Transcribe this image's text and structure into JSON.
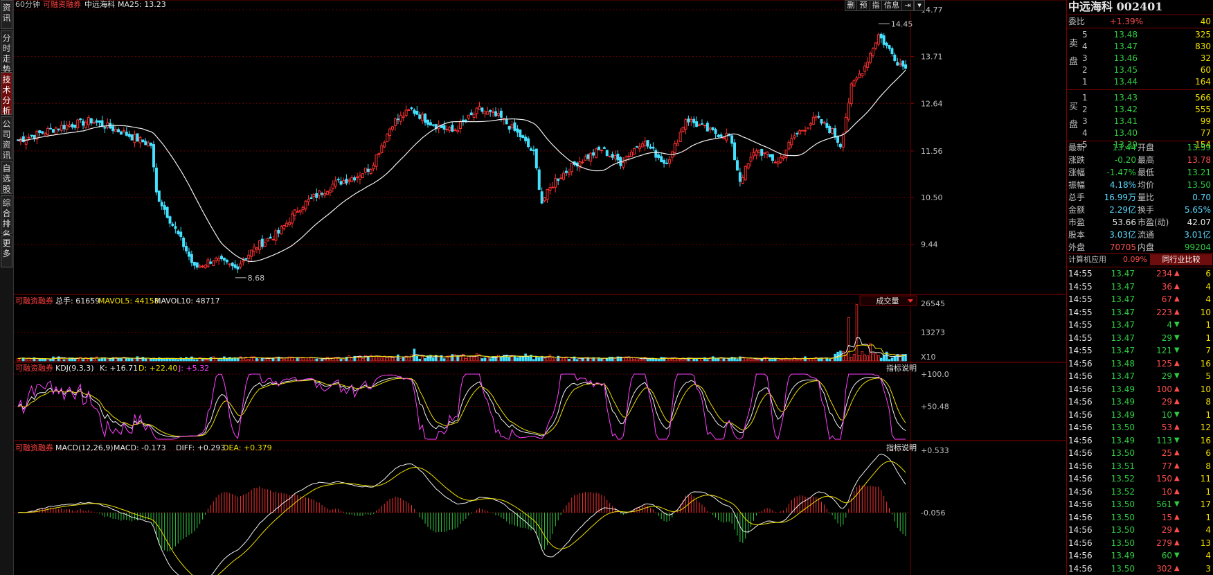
{
  "sidebar": {
    "tabs": [
      {
        "label": "资讯",
        "active": false
      },
      {
        "label": "分时走势",
        "active": false
      },
      {
        "label": "技术分析",
        "active": true
      },
      {
        "label": "公司资讯",
        "active": false
      },
      {
        "label": "自选股",
        "active": false
      },
      {
        "label": "综合排名",
        "active": false
      },
      {
        "label": "更多",
        "active": false
      }
    ]
  },
  "main_chart": {
    "period": "60分钟",
    "margin_tag": "可融资融券",
    "name": "中远海科",
    "ma_text": "MA25: 13.23",
    "price_axis": [
      "14.77",
      "13.71",
      "12.64",
      "11.56",
      "10.50",
      "9.44"
    ],
    "high_label": "14.45",
    "low_label": "8.68",
    "toolbar": [
      "删",
      "预",
      "指",
      "信息",
      "⇥",
      "▾"
    ]
  },
  "volume_panel": {
    "margin_tag": "可融资融券",
    "total": "总手: 61659",
    "mavol5": "MAVOL5: 44158",
    "mavol10": "MAVOL10: 48717",
    "dropdown": "成交量",
    "axis": [
      "26545",
      "13273",
      "X10"
    ]
  },
  "kdj_panel": {
    "margin_tag": "可融资融券",
    "title": "KDJ(9,3,3)",
    "k": "K: +16.71",
    "d": "D: +22.40",
    "j": "J: +5.32",
    "explain": "指标说明",
    "axis": [
      "+100.0",
      "+50.48"
    ]
  },
  "macd_panel": {
    "margin_tag": "可融资融券",
    "title": "MACD(12,26,9)",
    "macd": "MACD: -0.173",
    "diff": "DIFF: +0.293",
    "dea": "DEA: +0.379",
    "explain": "指标说明",
    "axis": [
      "+0.533",
      "-0.056"
    ]
  },
  "quote": {
    "title": "中远海科 002401",
    "weibi_label": "委比",
    "weibi": "+1.39%",
    "weibi_val": "40",
    "sell_label": [
      "卖",
      "盘"
    ],
    "buy_label": [
      "买",
      "盘"
    ],
    "asks": [
      {
        "lvl": "5",
        "price": "13.48",
        "vol": "325"
      },
      {
        "lvl": "4",
        "price": "13.47",
        "vol": "830"
      },
      {
        "lvl": "3",
        "price": "13.46",
        "vol": "32"
      },
      {
        "lvl": "2",
        "price": "13.45",
        "vol": "60"
      },
      {
        "lvl": "1",
        "price": "13.44",
        "vol": "164"
      }
    ],
    "bids": [
      {
        "lvl": "1",
        "price": "13.43",
        "vol": "566"
      },
      {
        "lvl": "2",
        "price": "13.42",
        "vol": "555"
      },
      {
        "lvl": "3",
        "price": "13.41",
        "vol": "99"
      },
      {
        "lvl": "4",
        "price": "13.40",
        "vol": "77"
      },
      {
        "lvl": "5",
        "price": "13.39",
        "vol": "154"
      }
    ],
    "stats": [
      {
        "l1": "最新",
        "v1": "13.44",
        "c1": "green",
        "l2": "开盘",
        "v2": "13.59",
        "c2": "green"
      },
      {
        "l1": "涨跌",
        "v1": "-0.20",
        "c1": "green",
        "l2": "最高",
        "v2": "13.78",
        "c2": "red"
      },
      {
        "l1": "涨幅",
        "v1": "-1.47%",
        "c1": "green",
        "l2": "最低",
        "v2": "13.21",
        "c2": "green"
      },
      {
        "l1": "振幅",
        "v1": "4.18%",
        "c1": "cyan",
        "l2": "均价",
        "v2": "13.50",
        "c2": "green"
      },
      {
        "l1": "总手",
        "v1": "16.99万",
        "c1": "cyan",
        "l2": "量比",
        "v2": "0.70",
        "c2": "cyan"
      },
      {
        "l1": "金额",
        "v1": "2.29亿",
        "c1": "cyan",
        "l2": "换手",
        "v2": "5.65%",
        "c2": "cyan"
      },
      {
        "l1": "市盈",
        "v1": "53.66",
        "c1": "white",
        "l2": "市盈(动)",
        "v2": "42.07",
        "c2": "white"
      },
      {
        "l1": "股本",
        "v1": "3.03亿",
        "c1": "cyan",
        "l2": "流通",
        "v2": "3.01亿",
        "c2": "cyan"
      },
      {
        "l1": "外盘",
        "v1": "70705",
        "c1": "red",
        "l2": "内盘",
        "v2": "99204",
        "c2": "green"
      }
    ],
    "industry": "计算机应用",
    "industry_pct": "0.09%",
    "compare_btn": "同行业比较"
  },
  "ticks": [
    {
      "time": "14:55",
      "price": "13.47",
      "vol": "234",
      "dir": "up",
      "n": "6"
    },
    {
      "time": "14:55",
      "price": "13.47",
      "vol": "36",
      "dir": "up",
      "n": "4"
    },
    {
      "time": "14:55",
      "price": "13.47",
      "vol": "67",
      "dir": "up",
      "n": "4"
    },
    {
      "time": "14:55",
      "price": "13.47",
      "vol": "223",
      "dir": "up",
      "n": "10"
    },
    {
      "time": "14:55",
      "price": "13.47",
      "vol": "4",
      "dir": "down",
      "n": "1"
    },
    {
      "time": "14:55",
      "price": "13.47",
      "vol": "29",
      "dir": "down",
      "n": "1"
    },
    {
      "time": "14:55",
      "price": "13.47",
      "vol": "121",
      "dir": "down",
      "n": "7"
    },
    {
      "time": "14:56",
      "price": "13.48",
      "vol": "125",
      "dir": "up",
      "n": "16"
    },
    {
      "time": "14:56",
      "price": "13.47",
      "vol": "29",
      "dir": "down",
      "n": "5"
    },
    {
      "time": "14:56",
      "price": "13.49",
      "vol": "100",
      "dir": "up",
      "n": "10"
    },
    {
      "time": "14:56",
      "price": "13.49",
      "vol": "29",
      "dir": "up",
      "n": "8"
    },
    {
      "time": "14:56",
      "price": "13.49",
      "vol": "10",
      "dir": "down",
      "n": "1"
    },
    {
      "time": "14:56",
      "price": "13.50",
      "vol": "53",
      "dir": "up",
      "n": "12"
    },
    {
      "time": "14:56",
      "price": "13.49",
      "vol": "113",
      "dir": "down",
      "n": "16"
    },
    {
      "time": "14:56",
      "price": "13.50",
      "vol": "25",
      "dir": "up",
      "n": "6"
    },
    {
      "time": "14:56",
      "price": "13.51",
      "vol": "77",
      "dir": "up",
      "n": "8"
    },
    {
      "time": "14:56",
      "price": "13.52",
      "vol": "150",
      "dir": "up",
      "n": "11"
    },
    {
      "time": "14:56",
      "price": "13.52",
      "vol": "10",
      "dir": "up",
      "n": "1"
    },
    {
      "time": "14:56",
      "price": "13.50",
      "vol": "561",
      "dir": "down",
      "n": "17"
    },
    {
      "time": "14:56",
      "price": "13.50",
      "vol": "15",
      "dir": "up",
      "n": "1"
    },
    {
      "time": "14:56",
      "price": "13.50",
      "vol": "29",
      "dir": "up",
      "n": "4"
    },
    {
      "time": "14:56",
      "price": "13.50",
      "vol": "279",
      "dir": "up",
      "n": "13"
    },
    {
      "time": "14:56",
      "price": "13.49",
      "vol": "60",
      "dir": "down",
      "n": "4"
    },
    {
      "time": "14:56",
      "price": "13.50",
      "vol": "302",
      "dir": "up",
      "n": "3"
    }
  ],
  "chart_data": {
    "type": "candlestick",
    "period": "60分钟",
    "price_ylim": [
      8.3,
      14.77
    ],
    "close_keypoints": [
      [
        0,
        11.8
      ],
      [
        15,
        12.1
      ],
      [
        27,
        12.25
      ],
      [
        38,
        12.0
      ],
      [
        45,
        11.8
      ],
      [
        49,
        11.7
      ],
      [
        51,
        10.6
      ],
      [
        56,
        10.0
      ],
      [
        62,
        9.3
      ],
      [
        65,
        8.9
      ],
      [
        72,
        9.1
      ],
      [
        80,
        8.9
      ],
      [
        88,
        9.4
      ],
      [
        96,
        9.7
      ],
      [
        104,
        10.3
      ],
      [
        116,
        10.8
      ],
      [
        125,
        11.0
      ],
      [
        130,
        11.2
      ],
      [
        138,
        12.2
      ],
      [
        145,
        12.5
      ],
      [
        152,
        12.2
      ],
      [
        160,
        12.0
      ],
      [
        170,
        12.5
      ],
      [
        178,
        12.3
      ],
      [
        185,
        11.9
      ],
      [
        190,
        11.5
      ],
      [
        193,
        10.4
      ],
      [
        198,
        10.9
      ],
      [
        206,
        11.3
      ],
      [
        215,
        11.6
      ],
      [
        222,
        11.3
      ],
      [
        230,
        11.8
      ],
      [
        238,
        11.3
      ],
      [
        241,
        11.5
      ],
      [
        246,
        12.3
      ],
      [
        255,
        12.0
      ],
      [
        262,
        11.9
      ],
      [
        266,
        10.9
      ],
      [
        272,
        11.6
      ],
      [
        280,
        11.3
      ],
      [
        286,
        11.9
      ],
      [
        294,
        12.3
      ],
      [
        300,
        12.0
      ],
      [
        303,
        11.7
      ],
      [
        307,
        13.0
      ],
      [
        312,
        13.5
      ],
      [
        317,
        14.2
      ],
      [
        324,
        13.6
      ],
      [
        327,
        13.44
      ]
    ],
    "ma25_label": "MA25: 13.23",
    "high": 14.45,
    "low": 8.68,
    "volume_ylim": [
      0,
      26545
    ],
    "kdj_ylim": [
      0,
      100
    ],
    "macd": {
      "diff": 0.293,
      "dea": 0.379,
      "macd": -0.173
    }
  }
}
